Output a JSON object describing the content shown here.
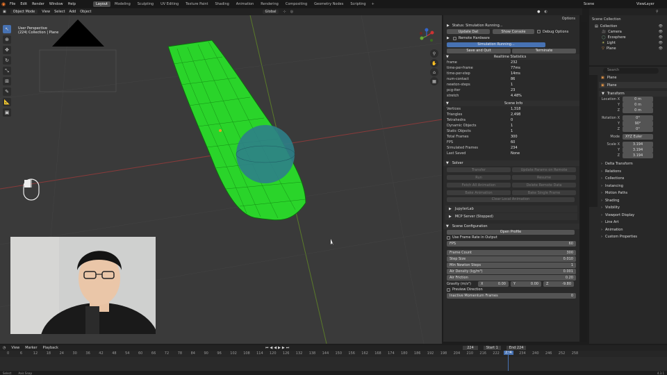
{
  "menu": [
    "File",
    "Edit",
    "Render",
    "Window",
    "Help"
  ],
  "workspaces": [
    "Layout",
    "Modeling",
    "Sculpting",
    "UV Editing",
    "Texture Paint",
    "Shading",
    "Animation",
    "Rendering",
    "Compositing",
    "Geometry Nodes",
    "Scripting"
  ],
  "scene": "Scene",
  "view_layer": "ViewLayer",
  "header": {
    "mode": "Object Mode",
    "view": "View",
    "select": "Select",
    "add": "Add",
    "object": "Object",
    "orientation": "Global",
    "options": "Options"
  },
  "viewport": {
    "perspective": "User Perspective",
    "collection": "(224) Collection | Plane"
  },
  "sim": {
    "status": "Status: Simulation Running...",
    "update_dat": "Update Dat",
    "show_console": "Show Console",
    "debug_options": "Debug Options",
    "remote_hardware": "Remote Hardware",
    "running_btn": "Simulation Running...",
    "save_quit": "Save and Quit",
    "terminate": "Terminate",
    "realtime_title": "Realtime Statistics",
    "realtime": [
      [
        "frame",
        "232"
      ],
      [
        "time-per-frame",
        "77ms"
      ],
      [
        "time-per-step",
        "14ms"
      ],
      [
        "num-contact",
        "86"
      ],
      [
        "newton-steps",
        "1"
      ],
      [
        "pcg-iter",
        "23"
      ],
      [
        "stretch",
        "4.48%"
      ]
    ],
    "scene_info_title": "Scene Info",
    "scene_info": [
      [
        "Vertices",
        "1,318"
      ],
      [
        "Triangles",
        "2,498"
      ],
      [
        "Tetrahedra",
        "0"
      ],
      [
        "Dynamic Objects",
        "1"
      ],
      [
        "Static Objects",
        "1"
      ],
      [
        "Total Frames",
        "300"
      ],
      [
        "FPS",
        "60"
      ],
      [
        "Simulated Frames",
        "234"
      ],
      [
        "Last Saved",
        "None"
      ]
    ],
    "solver": "Solver",
    "solver_btns": [
      [
        "Transfer",
        "Update Params on Remote"
      ],
      [
        "Run",
        "Resume"
      ],
      [
        "Fetch All Animation",
        "Delete Remote Data"
      ],
      [
        "Bake Animation",
        "Bake Single Frame"
      ]
    ],
    "clear_local": "Clear Local Animation",
    "jupyter": "JupyterLab",
    "mcp": "MCP Server (Stopped)",
    "scene_config": "Scene Configuration",
    "open_profile": "Open Profile",
    "use_frame_rate": "Use Frame Rate in Output",
    "config": [
      [
        "FPS",
        "60"
      ],
      [
        "Frame Count",
        "300"
      ],
      [
        "Step Size",
        "0.010"
      ],
      [
        "Min Newton Steps",
        "1"
      ],
      [
        "Air Density (kg/m³)",
        "0.001"
      ],
      [
        "Air Friction",
        "0.20"
      ]
    ],
    "gravity_label": "Gravity (m/s²)",
    "gravity": [
      "0.00",
      "0.00",
      "-9.80"
    ],
    "preview_direction": "Preview Direction",
    "inactive_momentum": "Inactive Momentum Frames",
    "inactive_value": "0"
  },
  "outliner": {
    "title": "Scene Collection",
    "items": [
      "Collection",
      "Camera",
      "Ecosphere",
      "Light",
      "Plane"
    ]
  },
  "props": {
    "object": "Plane",
    "search_placeholder": "Search",
    "transform": "Transform",
    "location": [
      "0 m",
      "0 m",
      "0 m"
    ],
    "rotation": [
      "0°",
      "90°",
      "0°"
    ],
    "mode": "XYZ Euler",
    "scale": [
      "3.194",
      "3.194",
      "3.194"
    ],
    "sections": [
      "Delta Transform",
      "Relations",
      "Collections",
      "Instancing",
      "Motion Paths",
      "Shading",
      "Visibility",
      "Viewport Display",
      "Line Art",
      "Animation",
      "Custom Properties"
    ]
  },
  "timeline": {
    "view": "View",
    "marker": "Marker",
    "playback": "Playback",
    "current": "224",
    "start_label": "Start",
    "start": "1",
    "end_label": "End",
    "end": "224",
    "ticks": [
      "0",
      "6",
      "12",
      "18",
      "24",
      "30",
      "36",
      "42",
      "48",
      "54",
      "60",
      "66",
      "72",
      "78",
      "84",
      "90",
      "96",
      "102",
      "108",
      "114",
      "120",
      "126",
      "132",
      "138",
      "144",
      "150",
      "156",
      "162",
      "168",
      "174",
      "180",
      "186",
      "192",
      "198",
      "204",
      "210",
      "216",
      "222",
      "228",
      "234",
      "240",
      "246",
      "252",
      "258"
    ]
  },
  "statusbar": {
    "left": "Select",
    "mid": "Axis Snap",
    "version": "4.3.1"
  }
}
